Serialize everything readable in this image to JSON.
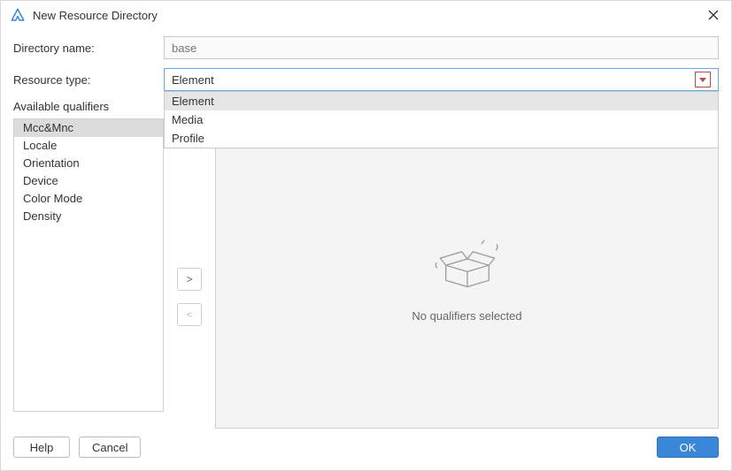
{
  "window": {
    "title": "New Resource Directory"
  },
  "form": {
    "directory_name_label": "Directory name:",
    "directory_name_placeholder": "base",
    "resource_type_label": "Resource type:",
    "resource_type_value": "Element",
    "resource_type_options": [
      "Element",
      "Media",
      "Profile"
    ]
  },
  "qualifiers": {
    "heading": "Available qualifiers",
    "items": [
      "Mcc&Mnc",
      "Locale",
      "Orientation",
      "Device",
      "Color Mode",
      "Density"
    ],
    "selected_index": 0
  },
  "transfer": {
    "add_label": ">",
    "remove_label": "<"
  },
  "right": {
    "empty_message": "No qualifiers selected"
  },
  "buttons": {
    "help": "Help",
    "cancel": "Cancel",
    "ok": "OK"
  }
}
